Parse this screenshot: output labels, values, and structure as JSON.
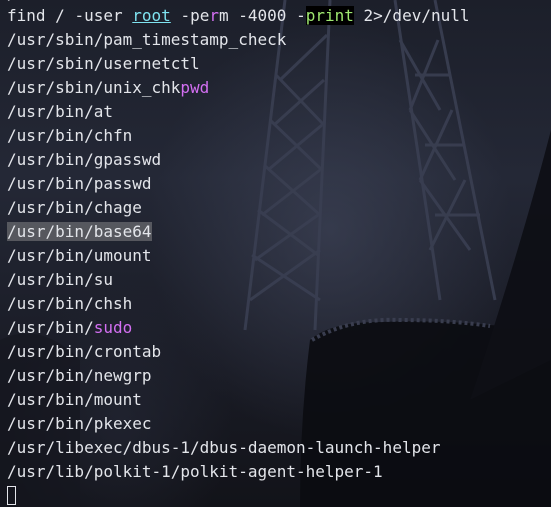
{
  "terminal": {
    "prev_line_fragment": "/ ",
    "command": {
      "find": "find",
      "slash": "/",
      "user_flag": "-user",
      "user_value": "root",
      "perm_flag_pre": "-pe",
      "perm_flag_r": "r",
      "perm_flag_post": "m",
      "perm_value": "-4000",
      "print_dash": "-",
      "print_word": "print",
      "redirect": "2>/dev/null"
    },
    "results": {
      "pam_timestamp_check": "/usr/sbin/pam_timestamp_check",
      "usernetctl": "/usr/sbin/usernetctl",
      "unix_chkpwd_prefix": "/usr/sbin/unix_chk",
      "unix_chkpwd_suffix": "pwd",
      "at": "/usr/bin/at",
      "chfn": "/usr/bin/chfn",
      "gpasswd": "/usr/bin/gpasswd",
      "passwd": "/usr/bin/passwd",
      "chage": "/usr/bin/chage",
      "base64": "/usr/bin/base64",
      "umount": "/usr/bin/umount",
      "su": "/usr/bin/su",
      "chsh": "/usr/bin/chsh",
      "sudo_prefix": "/usr/bin/",
      "sudo_suffix": "sudo",
      "crontab": "/usr/bin/crontab",
      "newgrp": "/usr/bin/newgrp",
      "mount": "/usr/bin/mount",
      "pkexec": "/usr/bin/pkexec",
      "dbus_helper": "/usr/libexec/dbus-1/dbus-daemon-launch-helper",
      "polkit_helper": "/usr/lib/polkit-1/polkit-agent-helper-1"
    }
  },
  "colors": {
    "text": "#e3e5ea",
    "root_highlight": "#7fe3f0",
    "print_highlight": "#9fe870",
    "search_match": "#d36ff2",
    "selection": "#969696"
  }
}
